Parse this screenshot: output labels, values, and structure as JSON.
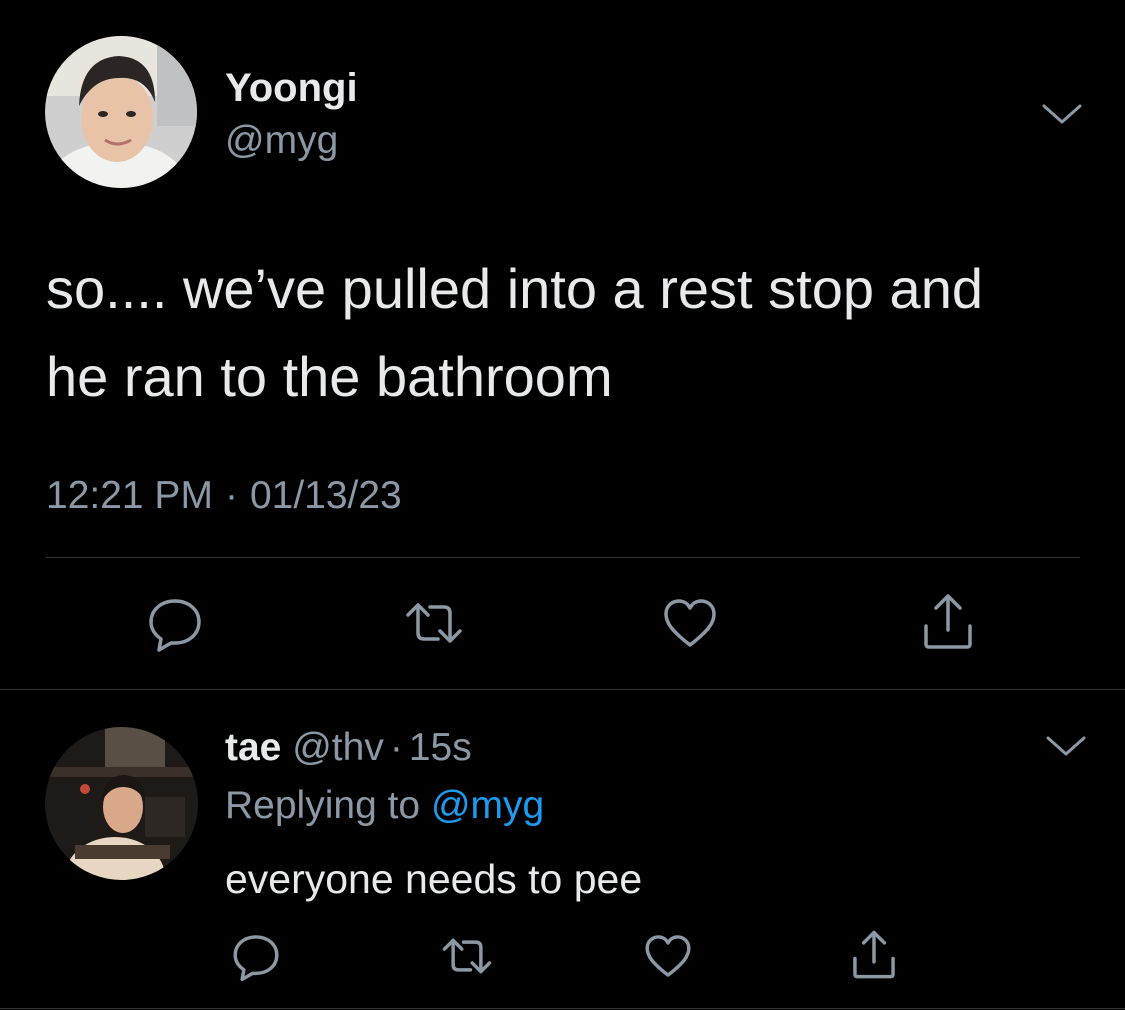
{
  "main_tweet": {
    "display_name": "Yoongi",
    "handle": "@myg",
    "text_line1": "so.... we’ve pulled into a rest stop and",
    "text_line2": "he ran to the bathroom",
    "time": "12:21 PM",
    "separator": "·",
    "date": "01/13/23",
    "avatar_icon": "profile-photo-yoongi",
    "menu_icon": "chevron-down-icon",
    "actions": [
      "reply-icon",
      "retweet-icon",
      "like-icon",
      "share-icon"
    ]
  },
  "reply": {
    "display_name": "tae",
    "handle": "@thv",
    "separator": "·",
    "time_ago": "15s",
    "replying_prefix": "Replying to",
    "replying_to": "@myg",
    "text": "everyone needs to pee",
    "avatar_icon": "profile-photo-tae",
    "menu_icon": "chevron-down-icon",
    "actions": [
      "reply-icon",
      "retweet-icon",
      "like-icon",
      "share-icon"
    ]
  },
  "colors": {
    "background": "#000000",
    "primary_text": "#e7e9ea",
    "secondary_text": "#8b98a5",
    "link": "#1d9bf0",
    "divider": "#2f3336"
  }
}
